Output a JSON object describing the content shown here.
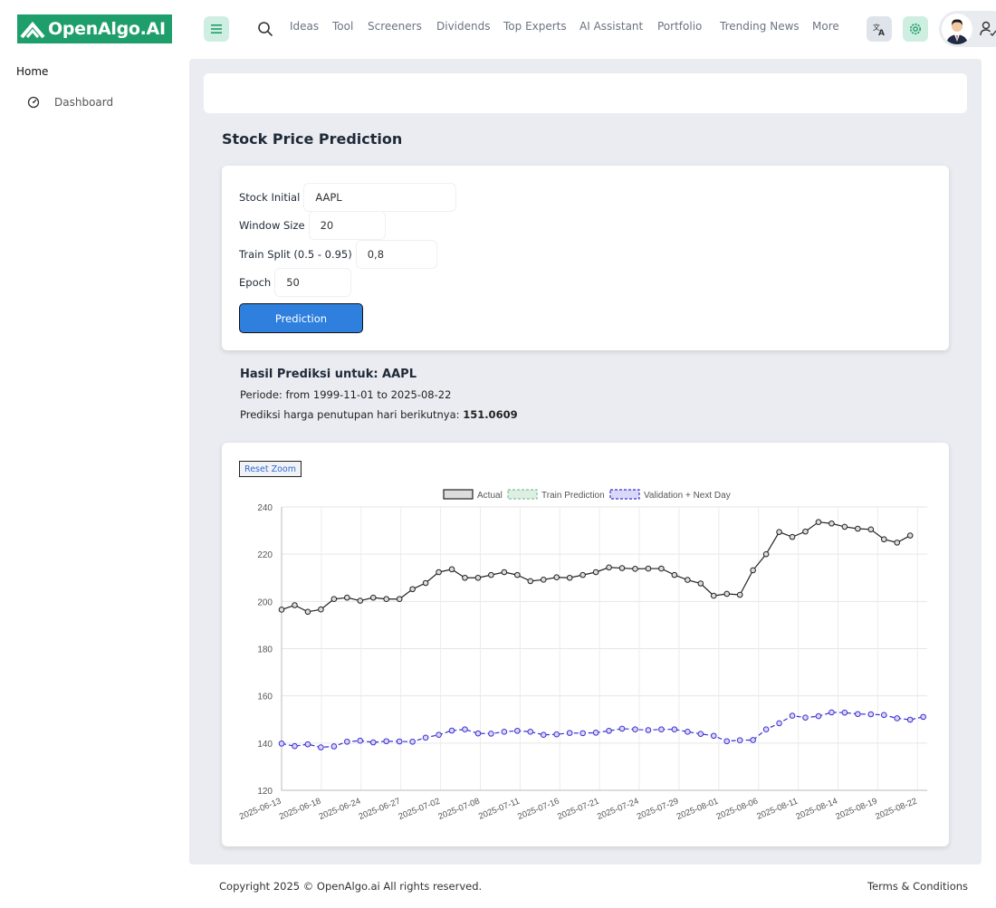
{
  "brand": {
    "name": "OpenAlgo.AI",
    "color": "#1e9e6a"
  },
  "header": {
    "nav": [
      "Ideas",
      "Tool",
      "Screeners",
      "Dividends",
      "Top Experts",
      "AI Assistant",
      "Portfolio",
      "Trending News",
      "More"
    ],
    "icons": {
      "menu": "hamburger-icon",
      "search": "search-icon",
      "translate": "translate-icon",
      "settings": "gear-icon",
      "user": "user-icon"
    }
  },
  "sidebar": {
    "home": "Home",
    "items": [
      {
        "label": "Dashboard",
        "icon": "dashboard-gauge-icon"
      }
    ]
  },
  "page": {
    "title": "Stock Price Prediction"
  },
  "form": {
    "stock_label": "Stock Initial",
    "stock_value": "AAPL",
    "window_label": "Window Size",
    "window_value": "20",
    "split_label": "Train Split (0.5 - 0.95)",
    "split_value": "0,8",
    "epoch_label": "Epoch",
    "epoch_value": "50",
    "submit_label": "Prediction",
    "accent": "#2f7fde"
  },
  "result": {
    "title": "Hasil Prediksi untuk: AAPL",
    "period": "Periode: from 1999-11-01 to 2025-08-22",
    "next_day_label": "Prediksi harga penutupan hari berikutnya:",
    "next_day_value": "151.0609"
  },
  "chart_controls": {
    "reset_zoom": "Reset Zoom"
  },
  "chart_data": {
    "type": "line",
    "legend_position": "top",
    "grid": true,
    "ylim": [
      120,
      240
    ],
    "yticks": [
      120,
      140,
      160,
      180,
      200,
      220,
      240
    ],
    "xtick_labels": [
      "2025-06-13",
      "2025-06-18",
      "2025-06-24",
      "2025-06-27",
      "2025-07-02",
      "2025-07-08",
      "2025-07-11",
      "2025-07-16",
      "2025-07-21",
      "2025-07-24",
      "2025-07-29",
      "2025-08-01",
      "2025-08-06",
      "2025-08-11",
      "2025-08-14",
      "2025-08-19",
      "2025-08-22"
    ],
    "series": [
      {
        "name": "Actual",
        "color": "#222222",
        "dashed": false,
        "values": [
          196.5,
          198.4,
          195.6,
          196.6,
          201.0,
          201.6,
          200.3,
          201.6,
          201.0,
          201.0,
          205.2,
          207.8,
          212.4,
          213.6,
          210.0,
          210.0,
          211.2,
          212.4,
          211.2,
          208.6,
          209.2,
          210.2,
          210.0,
          211.2,
          212.4,
          214.4,
          214.1,
          213.8,
          213.9,
          213.9,
          211.2,
          209.1,
          207.6,
          202.4,
          203.2,
          202.8,
          213.2,
          220.0,
          229.4,
          227.3,
          229.6,
          233.6,
          233.0,
          231.6,
          230.8,
          230.5,
          226.3,
          224.9,
          227.9
        ]
      },
      {
        "name": "Train Prediction",
        "color": "#7cc39a",
        "dashed": true,
        "values": []
      },
      {
        "name": "Validation + Next Day",
        "color": "#3a2fd0",
        "dashed": true,
        "values": [
          139.8,
          138.7,
          139.5,
          138.2,
          138.6,
          140.6,
          141.0,
          140.3,
          140.8,
          140.7,
          140.6,
          142.3,
          143.5,
          145.3,
          145.8,
          144.1,
          144.0,
          144.8,
          145.2,
          144.8,
          143.5,
          143.7,
          144.3,
          144.2,
          144.4,
          145.2,
          146.1,
          145.8,
          145.5,
          145.8,
          145.8,
          144.8,
          143.9,
          143.1,
          140.8,
          141.2,
          141.3,
          145.8,
          148.4,
          151.6,
          150.8,
          151.4,
          153.0,
          152.9,
          152.3,
          152.2,
          151.9,
          150.5,
          149.9,
          151.1
        ]
      }
    ]
  },
  "footer": {
    "copyright": "Copyright 2025 © OpenAlgo.ai All rights reserved.",
    "terms": "Terms & Conditions"
  }
}
